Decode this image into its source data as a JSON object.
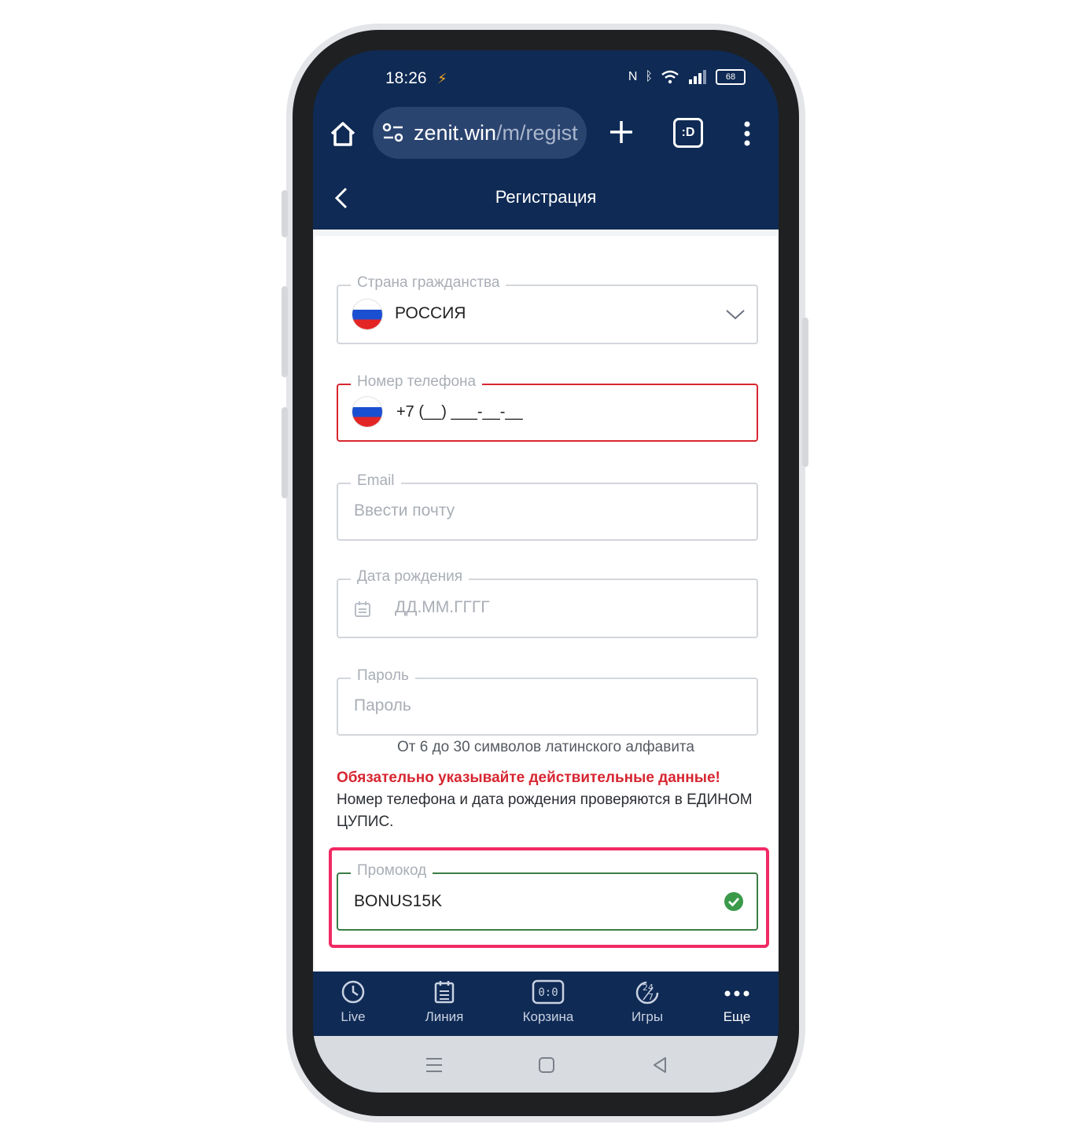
{
  "status_bar": {
    "time": "18:26",
    "battery": "68"
  },
  "browser": {
    "url_main": "zenit.win",
    "url_path": "/m/regist",
    "tabs_label": ":D"
  },
  "header": {
    "title": "Регистрация"
  },
  "form": {
    "country": {
      "label": "Страна гражданства",
      "value": "РОССИЯ"
    },
    "phone": {
      "label": "Номер телефона",
      "value": "+7 (__) ___-__-__"
    },
    "email": {
      "label": "Email",
      "placeholder": "Ввести почту"
    },
    "birthdate": {
      "label": "Дата рождения",
      "placeholder": "ДД.ММ.ГГГГ"
    },
    "password": {
      "label": "Пароль",
      "placeholder": "Пароль",
      "hint": "От 6 до 30 символов латинского алфавита"
    },
    "warning_title": "Обязательно указывайте действительные данные!",
    "warning_text": "Номер телефона и дата рождения проверяются в ЕДИНОМ ЦУПИС.",
    "promo": {
      "label": "Промокод",
      "value": "BONUS15K"
    }
  },
  "bottom_nav": [
    {
      "label": "Live",
      "icon": "clock-icon"
    },
    {
      "label": "Линия",
      "icon": "list-icon"
    },
    {
      "label": "Корзина",
      "icon": "scoreboard-icon"
    },
    {
      "label": "Игры",
      "icon": "games-24-7-icon"
    },
    {
      "label": "Еще",
      "icon": "more-dots-icon"
    }
  ],
  "colors": {
    "primary": "#0f2a54",
    "error": "#d72631",
    "valid": "#3a9a4a",
    "highlight": "#f12a64"
  }
}
